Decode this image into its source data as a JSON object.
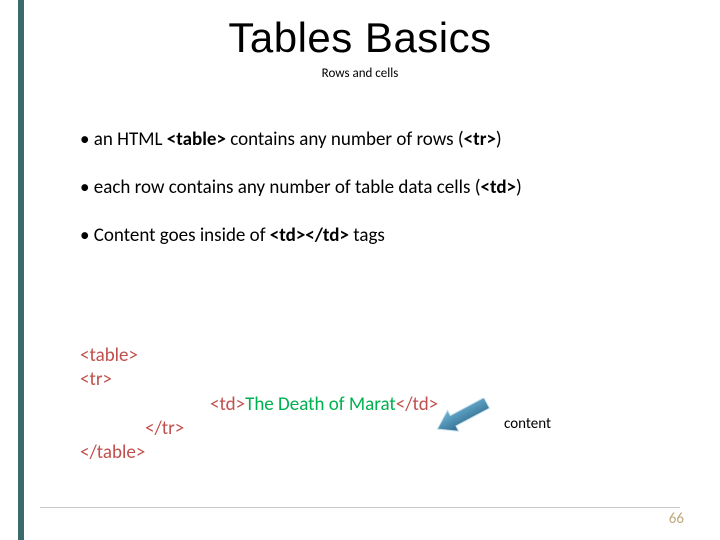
{
  "title": "Tables Basics",
  "subtitle": "Rows and cells",
  "bullets": {
    "b1_pre": "an HTML ",
    "b1_bold": "<table>",
    "b1_post": " contains any number of rows (",
    "b1_bold2": "<tr>",
    "b1_close": ")",
    "b2_pre": "each row contains any number of table data cells (",
    "b2_bold": "<td>",
    "b2_close": ")",
    "b3_pre": "Content goes inside of ",
    "b3_bold": "<td></td>",
    "b3_post": " tags"
  },
  "code": {
    "l1": "<table>",
    "l2": "<tr>",
    "l3_open": "<td>",
    "l3_text": "The Death of Marat",
    "l3_close": "</td>",
    "l4": "</tr>",
    "l5": "</table>"
  },
  "content_label": "content",
  "page_number": "66"
}
